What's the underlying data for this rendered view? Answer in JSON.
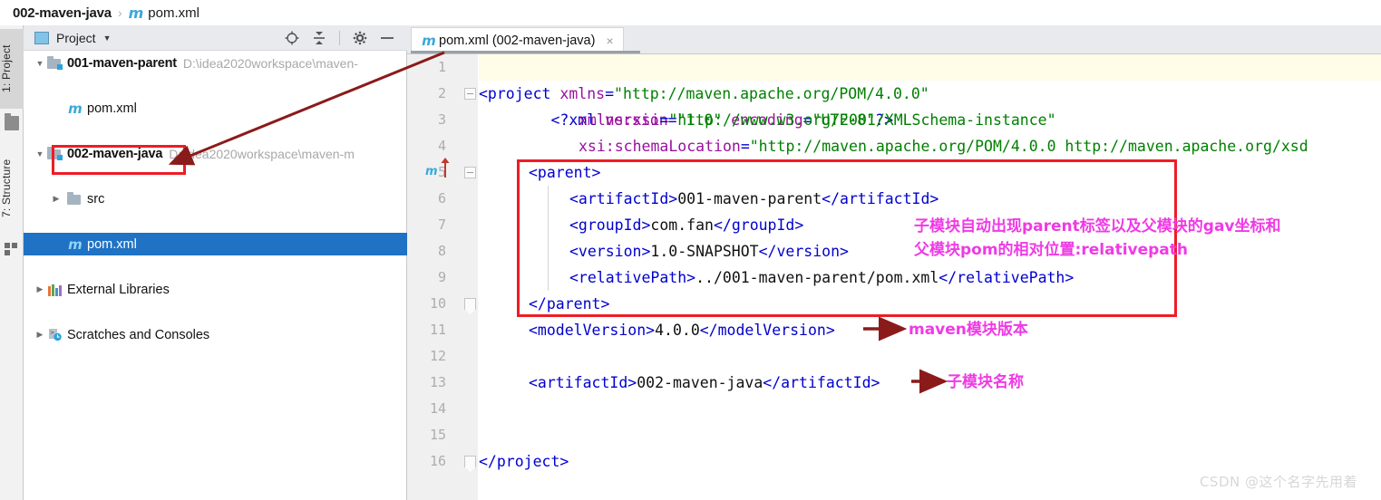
{
  "breadcrumb": {
    "project": "002-maven-java",
    "separator": "›",
    "file_icon": "m",
    "file": "pom.xml"
  },
  "toolstrip": {
    "tabs": [
      {
        "label": "1: Project",
        "icon": "folder-icon",
        "active": true
      },
      {
        "label": "7: Structure",
        "icon": "modules-icon",
        "active": false
      }
    ]
  },
  "project_panel": {
    "title": "Project",
    "caret": "▼",
    "tools": [
      {
        "name": "locate-icon",
        "glyph": "⊕"
      },
      {
        "name": "collapse-all-icon",
        "glyph": "⤓"
      },
      {
        "name": "settings-gear-icon",
        "glyph": "⚙"
      },
      {
        "name": "hide-icon",
        "glyph": "—"
      }
    ],
    "tree": [
      {
        "indent": 0,
        "twist": "▼",
        "icon": "module-icon",
        "label": "001-maven-parent",
        "bold": true,
        "path": "D:\\idea2020workspace\\maven-",
        "selected": false
      },
      {
        "indent": 1,
        "twist": "",
        "icon": "maven-icon",
        "label": "pom.xml",
        "bold": false,
        "path": "",
        "selected": false
      },
      {
        "indent": 0,
        "twist": "▼",
        "icon": "module-icon",
        "label": "002-maven-java",
        "bold": true,
        "path": "D:\\idea2020workspace\\maven-m",
        "selected": false
      },
      {
        "indent": 1,
        "twist": "▶",
        "icon": "folder-icon",
        "label": "src",
        "bold": false,
        "path": "",
        "selected": false
      },
      {
        "indent": 1,
        "twist": "",
        "icon": "maven-icon",
        "label": "pom.xml",
        "bold": false,
        "path": "",
        "selected": true
      },
      {
        "indent": 0,
        "twist": "▶",
        "icon": "libraries-icon",
        "label": "External Libraries",
        "bold": false,
        "path": "",
        "selected": false
      },
      {
        "indent": 0,
        "twist": "▶",
        "icon": "scratches-icon",
        "label": "Scratches and Consoles",
        "bold": false,
        "path": "",
        "selected": false
      }
    ]
  },
  "editor": {
    "tab": {
      "icon": "m",
      "label": "pom.xml (002-maven-java)",
      "close": "×"
    },
    "lines": [
      {
        "num": "1",
        "highlight": true,
        "fold": "",
        "gutter_mvn": false
      },
      {
        "num": "2",
        "highlight": false,
        "fold": "minus",
        "gutter_mvn": false
      },
      {
        "num": "3",
        "highlight": false,
        "fold": "",
        "gutter_mvn": false
      },
      {
        "num": "4",
        "highlight": false,
        "fold": "",
        "gutter_mvn": false
      },
      {
        "num": "5",
        "highlight": false,
        "fold": "minus",
        "gutter_mvn": true
      },
      {
        "num": "6",
        "highlight": false,
        "fold": "",
        "gutter_mvn": false
      },
      {
        "num": "7",
        "highlight": false,
        "fold": "",
        "gutter_mvn": false
      },
      {
        "num": "8",
        "highlight": false,
        "fold": "",
        "gutter_mvn": false
      },
      {
        "num": "9",
        "highlight": false,
        "fold": "",
        "gutter_mvn": false
      },
      {
        "num": "10",
        "highlight": false,
        "fold": "point",
        "gutter_mvn": false
      },
      {
        "num": "11",
        "highlight": false,
        "fold": "",
        "gutter_mvn": false
      },
      {
        "num": "12",
        "highlight": false,
        "fold": "",
        "gutter_mvn": false
      },
      {
        "num": "13",
        "highlight": false,
        "fold": "",
        "gutter_mvn": false
      },
      {
        "num": "14",
        "highlight": false,
        "fold": "",
        "gutter_mvn": false
      },
      {
        "num": "15",
        "highlight": false,
        "fold": "",
        "gutter_mvn": false
      },
      {
        "num": "16",
        "highlight": false,
        "fold": "point",
        "gutter_mvn": false
      }
    ],
    "code": {
      "l1": "<?xml version=\"1.0\" encoding=\"UTF-8\"?>",
      "l2": "<project xmlns=\"http://maven.apache.org/POM/4.0.0\"",
      "l3": "xmlns:xsi=\"http://www.w3.org/2001/XMLSchema-instance\"",
      "l4": "xsi:schemaLocation=\"http://maven.apache.org/POM/4.0.0 http://maven.apache.org/xsd",
      "l5": "<parent>",
      "l6": "<artifactId>001-maven-parent</artifactId>",
      "l7": "<groupId>com.fan</groupId>",
      "l8": "<version>1.0-SNAPSHOT</version>",
      "l9": "<relativePath>../001-maven-parent/pom.xml</relativePath>",
      "l10": "</parent>",
      "l11": "<modelVersion>4.0.0</modelVersion>",
      "l13": "<artifactId>002-maven-java</artifactId>",
      "l16": "</project>"
    }
  },
  "annotations": {
    "parent_note_line1": "子模块自动出现parent标签以及父模块的gav坐标和",
    "parent_note_line2": "父模块pom的相对位置:relativepath",
    "model_version_note": "maven模块版本",
    "artifact_note": "子模块名称"
  },
  "watermark": "CSDN @这个名字先用着",
  "colors": {
    "selection_blue": "#1f72c4",
    "annotation_magenta": "#ef3ae5",
    "redbox": "#ee1c25",
    "arrow_dark_red": "#8b1a1a",
    "maven_icon_blue": "#3aa8d8",
    "xml_tag_blue": "#0000cf",
    "xml_attr_purple": "#9b0fa0",
    "xml_string_green": "#008000",
    "line_highlight": "#fffce8"
  }
}
